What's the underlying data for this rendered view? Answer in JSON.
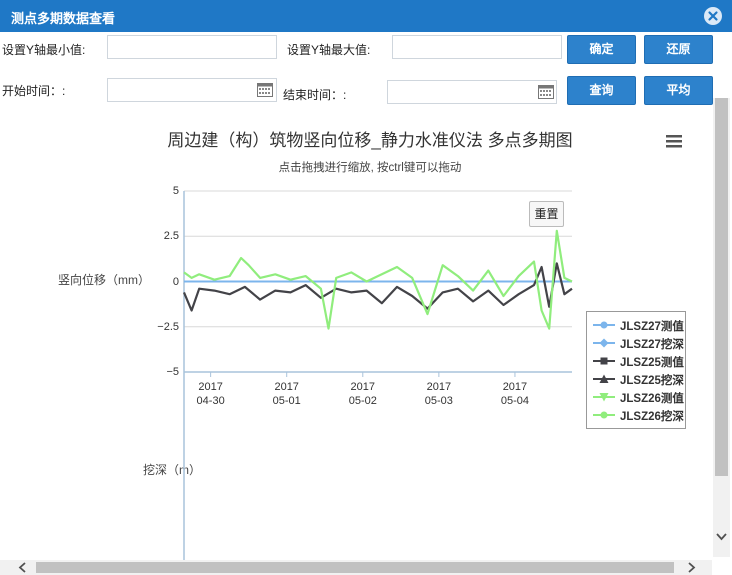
{
  "window": {
    "title": "测点多期数据查看",
    "close_icon": "close-circle-icon"
  },
  "form": {
    "ymin_label": "设置Y轴最小值:",
    "ymin_value": "",
    "ymax_label": "设置Y轴最大值:",
    "ymax_value": "",
    "start_label": "开始时间：:",
    "start_value": "",
    "end_label": "结束时间：:",
    "end_value": "",
    "calendar_icon": "calendar-icon"
  },
  "buttons": {
    "confirm": "确定",
    "restore": "还原",
    "query": "查询",
    "average": "平均"
  },
  "chart": {
    "reset_label": "重置",
    "menu_icon": "hamburger-menu-icon"
  },
  "chart_data": {
    "type": "line",
    "title": "周边建（构）筑物竖向位移_静力水准仪法 多点多期图",
    "subtitle": "点击拖拽进行缩放, 按ctrl键可以拖动",
    "ylabel": "竖向位移（mm）",
    "ylabel2": "挖深（m）",
    "ylim": [
      -5,
      5
    ],
    "yticks": [
      "5",
      "2.5",
      "0",
      "−2.5",
      "−5"
    ],
    "xlim": [
      0.0,
      5.1
    ],
    "xticks": [
      {
        "year": "2017",
        "date": "04-30",
        "x": 0.35
      },
      {
        "year": "2017",
        "date": "05-01",
        "x": 1.35
      },
      {
        "year": "2017",
        "date": "05-02",
        "x": 2.35
      },
      {
        "year": "2017",
        "date": "05-03",
        "x": 3.35
      },
      {
        "year": "2017",
        "date": "05-04",
        "x": 4.35
      }
    ],
    "grid": true,
    "legend_position": "right",
    "series": [
      {
        "name": "JLSZ27测值",
        "color": "#7cb5ec",
        "marker": "circle",
        "x": [
          0.0,
          1.0,
          2.0,
          2.7,
          3.3,
          4.0,
          5.1
        ],
        "y": [
          0.0,
          0.0,
          0.0,
          0.0,
          0.0,
          0.0,
          0.0
        ]
      },
      {
        "name": "JLSZ27挖深",
        "color": "#7cb5ec",
        "marker": "diamond",
        "x": [],
        "y": []
      },
      {
        "name": "JLSZ25测值",
        "color": "#434348",
        "marker": "square",
        "x": [
          0.0,
          0.1,
          0.2,
          0.4,
          0.6,
          0.8,
          1.0,
          1.2,
          1.4,
          1.6,
          1.8,
          2.0,
          2.2,
          2.4,
          2.6,
          2.8,
          3.0,
          3.2,
          3.4,
          3.6,
          3.8,
          4.0,
          4.2,
          4.4,
          4.6,
          4.7,
          4.8,
          4.9,
          5.0,
          5.1
        ],
        "y": [
          -0.6,
          -1.6,
          -0.4,
          -0.5,
          -0.7,
          -0.3,
          -1.0,
          -0.5,
          -0.6,
          -0.2,
          -0.9,
          -0.4,
          -0.6,
          -0.5,
          -1.2,
          -0.3,
          -0.8,
          -1.5,
          -0.6,
          -0.4,
          -1.1,
          -0.5,
          -1.3,
          -0.7,
          -0.2,
          0.8,
          -1.4,
          1.0,
          -0.7,
          -0.4
        ]
      },
      {
        "name": "JLSZ25挖深",
        "color": "#434348",
        "marker": "triangle",
        "x": [],
        "y": []
      },
      {
        "name": "JLSZ26测值",
        "color": "#90ed7d",
        "marker": "triangle-down",
        "x": [
          0.0,
          0.1,
          0.2,
          0.4,
          0.6,
          0.75,
          0.85,
          1.0,
          1.2,
          1.4,
          1.6,
          1.8,
          1.9,
          2.0,
          2.2,
          2.4,
          2.6,
          2.8,
          3.0,
          3.2,
          3.4,
          3.6,
          3.8,
          4.0,
          4.2,
          4.4,
          4.6,
          4.7,
          4.8,
          4.9,
          5.0,
          5.1
        ],
        "y": [
          0.5,
          0.2,
          0.4,
          0.1,
          0.3,
          1.3,
          0.9,
          0.2,
          0.4,
          0.1,
          0.3,
          -0.4,
          -2.6,
          0.2,
          0.5,
          0.0,
          0.4,
          0.8,
          0.2,
          -1.8,
          0.9,
          0.3,
          -0.5,
          0.6,
          -0.8,
          0.3,
          1.1,
          -1.6,
          -2.6,
          2.8,
          0.2,
          0.0
        ]
      },
      {
        "name": "JLSZ26挖深",
        "color": "#90ed7d",
        "marker": "circle",
        "x": [],
        "y": []
      }
    ]
  }
}
